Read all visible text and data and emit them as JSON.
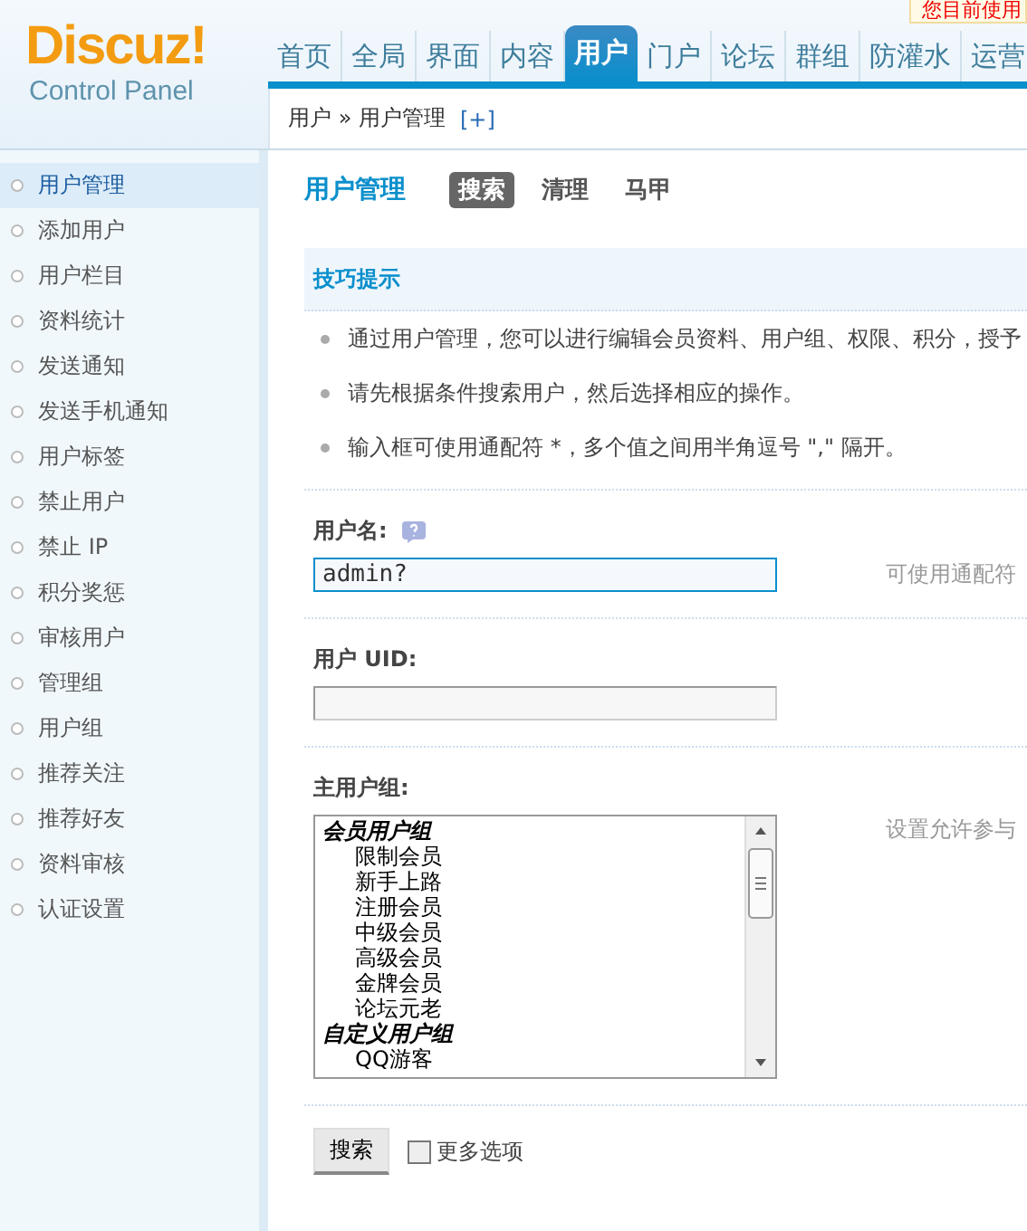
{
  "logo": {
    "name": "Discuz!",
    "subtitle": "Control Panel"
  },
  "nav": [
    {
      "label": "首页",
      "selected": false
    },
    {
      "label": "全局",
      "selected": false
    },
    {
      "label": "界面",
      "selected": false
    },
    {
      "label": "内容",
      "selected": false
    },
    {
      "label": "用户",
      "selected": true
    },
    {
      "label": "门户",
      "selected": false
    },
    {
      "label": "论坛",
      "selected": false
    },
    {
      "label": "群组",
      "selected": false
    },
    {
      "label": "防灌水",
      "selected": false
    },
    {
      "label": "运营",
      "selected": false
    }
  ],
  "notice": "您目前使用",
  "breadcrumb": {
    "path": "用户 » 用户管理",
    "add": "[+]"
  },
  "sidebar": [
    {
      "label": "用户管理",
      "selected": true
    },
    {
      "label": "添加用户",
      "selected": false
    },
    {
      "label": "用户栏目",
      "selected": false
    },
    {
      "label": "资料统计",
      "selected": false
    },
    {
      "label": "发送通知",
      "selected": false
    },
    {
      "label": "发送手机通知",
      "selected": false
    },
    {
      "label": "用户标签",
      "selected": false
    },
    {
      "label": "禁止用户",
      "selected": false
    },
    {
      "label": "禁止 IP",
      "selected": false
    },
    {
      "label": "积分奖惩",
      "selected": false
    },
    {
      "label": "审核用户",
      "selected": false
    },
    {
      "label": "管理组",
      "selected": false
    },
    {
      "label": "用户组",
      "selected": false
    },
    {
      "label": "推荐关注",
      "selected": false
    },
    {
      "label": "推荐好友",
      "selected": false
    },
    {
      "label": "资料审核",
      "selected": false
    },
    {
      "label": "认证设置",
      "selected": false
    }
  ],
  "page": {
    "title": "用户管理",
    "tabs": [
      {
        "label": "搜索",
        "selected": true
      },
      {
        "label": "清理",
        "selected": false
      },
      {
        "label": "马甲",
        "selected": false
      }
    ]
  },
  "tips": {
    "title": "技巧提示",
    "items": [
      "通过用户管理，您可以进行编辑会员资料、用户组、权限、积分，授予",
      "请先根据条件搜索用户，然后选择相应的操作。",
      "输入框可使用通配符 *，多个值之间用半角逗号 \",\" 隔开。"
    ]
  },
  "form": {
    "username": {
      "label": "用户名:",
      "value": "admin?",
      "hint": "可使用通配符"
    },
    "uid": {
      "label": "用户 UID:"
    },
    "group": {
      "label": "主用户组:",
      "hint": "设置允许参与",
      "options": [
        {
          "label": "会员用户组",
          "kind": "group"
        },
        {
          "label": "限制会员",
          "kind": "option"
        },
        {
          "label": "新手上路",
          "kind": "option"
        },
        {
          "label": "注册会员",
          "kind": "option"
        },
        {
          "label": "中级会员",
          "kind": "option"
        },
        {
          "label": "高级会员",
          "kind": "option"
        },
        {
          "label": "金牌会员",
          "kind": "option"
        },
        {
          "label": "论坛元老",
          "kind": "option"
        },
        {
          "label": "自定义用户组",
          "kind": "group"
        },
        {
          "label": "QQ游客",
          "kind": "option"
        }
      ]
    }
  },
  "submit": "搜索",
  "more": {
    "label": "更多选项",
    "checked": false
  }
}
